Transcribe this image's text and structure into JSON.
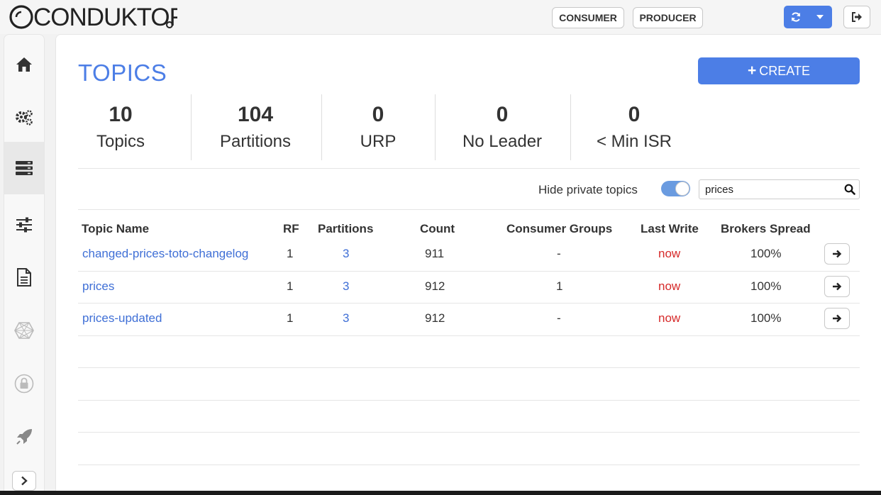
{
  "header": {
    "logo_text": "CONDUKTOR",
    "consumer_label": "CONSUMER",
    "producer_label": "PRODUCER",
    "refresh_icon": "refresh-icon",
    "dropdown_icon": "caret-down-icon",
    "logout_icon": "sign-out-icon"
  },
  "sidebar": {
    "items": [
      {
        "name": "home",
        "icon": "home-icon"
      },
      {
        "name": "settings",
        "icon": "gears-icon"
      },
      {
        "name": "topics",
        "icon": "server-icon",
        "active": true
      },
      {
        "name": "configuration",
        "icon": "sliders-icon"
      },
      {
        "name": "schema",
        "icon": "document-icon"
      },
      {
        "name": "network",
        "icon": "globe-network-icon"
      },
      {
        "name": "security",
        "icon": "lock-icon"
      },
      {
        "name": "deploy",
        "icon": "rocket-icon"
      }
    ],
    "collapse_icon": "chevron-right-icon"
  },
  "page": {
    "title": "TOPICS",
    "create_label": "CREATE"
  },
  "stats": [
    {
      "value": "10",
      "label": "Topics"
    },
    {
      "value": "104",
      "label": "Partitions"
    },
    {
      "value": "0",
      "label": "URP"
    },
    {
      "value": "0",
      "label": "No Leader"
    },
    {
      "value": "0",
      "label": "< Min ISR"
    }
  ],
  "filters": {
    "hide_private_label": "Hide private topics",
    "hide_private_on": true,
    "search_value": "prices"
  },
  "table": {
    "columns": [
      "Topic Name",
      "RF",
      "Partitions",
      "Count",
      "Consumer Groups",
      "Last Write",
      "Brokers Spread"
    ],
    "rows": [
      {
        "name": "changed-prices-toto-changelog",
        "rf": "1",
        "partitions": "3",
        "count": "911",
        "consumer_groups": "-",
        "last_write": "now",
        "brokers_spread": "100%"
      },
      {
        "name": "prices",
        "rf": "1",
        "partitions": "3",
        "count": "912",
        "consumer_groups": "1",
        "last_write": "now",
        "brokers_spread": "100%"
      },
      {
        "name": "prices-updated",
        "rf": "1",
        "partitions": "3",
        "count": "912",
        "consumer_groups": "-",
        "last_write": "now",
        "brokers_spread": "100%"
      }
    ]
  },
  "colors": {
    "accent": "#4c7ee6",
    "link": "#3f6fd6",
    "last_write": "#d62a2a"
  }
}
